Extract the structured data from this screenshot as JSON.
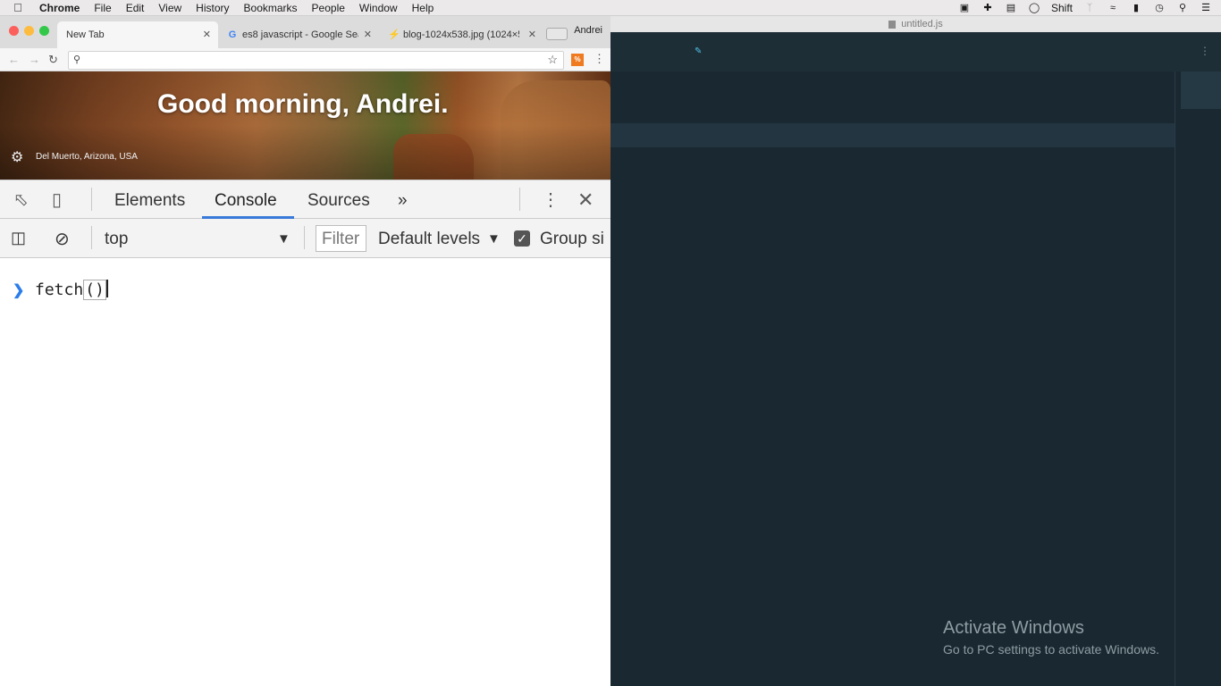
{
  "menubar": {
    "app": "Chrome",
    "items": [
      "File",
      "Edit",
      "View",
      "History",
      "Bookmarks",
      "People",
      "Window",
      "Help"
    ],
    "status_text": "Shift"
  },
  "editor": {
    "title": "untitled.js",
    "watermark_title": "Activate Windows",
    "watermark_sub": "Go to PC settings to activate Windows."
  },
  "chrome": {
    "tabs": [
      {
        "title": "New Tab",
        "icon": "blank-icon"
      },
      {
        "title": "es8 javascript - Google Searc",
        "icon": "google-icon"
      },
      {
        "title": "blog-1024x538.jpg (1024×53",
        "icon": "bolt-icon"
      }
    ],
    "profile": "Andrei",
    "omnibox_value": "",
    "extension_label": "%",
    "greeting": "Good morning, Andrei.",
    "location": "Del Muerto, Arizona, USA"
  },
  "devtools": {
    "tabs": [
      "Elements",
      "Console",
      "Sources"
    ],
    "active_tab": "Console",
    "context": "top",
    "filter_placeholder": "Filter",
    "levels": "Default levels",
    "group_similar": "Group si",
    "console_input": "fetch()",
    "console_input_fn": "fetch",
    "console_input_parens": "()"
  },
  "colors": {
    "accent": "#3879d9",
    "editor_bg": "#1b2a33"
  }
}
